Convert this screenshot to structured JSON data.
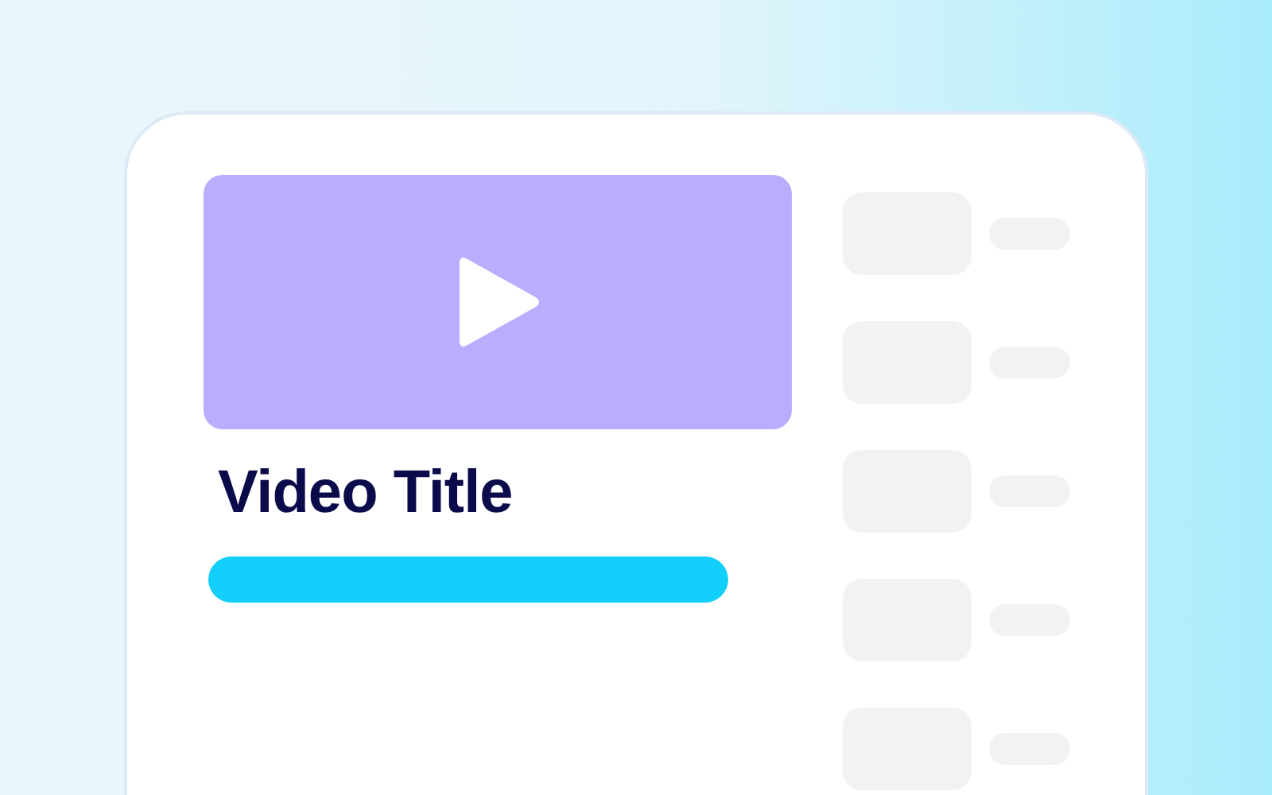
{
  "video": {
    "title": "Video Title"
  },
  "related": [
    {
      "kind": "placeholder"
    },
    {
      "kind": "placeholder"
    },
    {
      "kind": "placeholder"
    },
    {
      "kind": "placeholder"
    },
    {
      "kind": "placeholder"
    }
  ]
}
